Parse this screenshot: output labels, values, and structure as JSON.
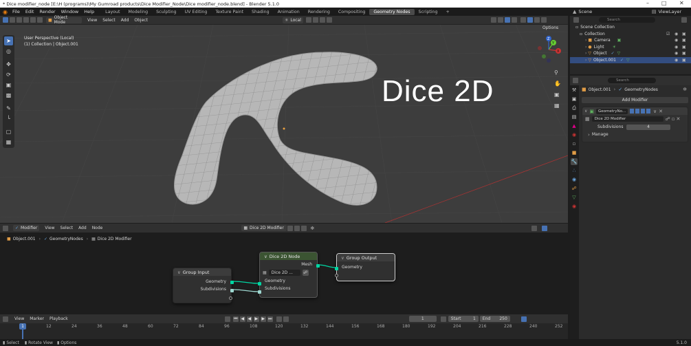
{
  "title_bar": {
    "title": "* Dice modifier_node [E:\\H (programs)\\My Gumroad products\\Dice Modifier_Node\\Dice modifier_node.blend] - Blender 5.1.0",
    "minimize": "–",
    "maximize": "□",
    "close": "✕"
  },
  "menu": [
    "File",
    "Edit",
    "Render",
    "Window",
    "Help"
  ],
  "workspaces": [
    {
      "label": "Layout",
      "active": false
    },
    {
      "label": "Modeling",
      "active": false
    },
    {
      "label": "Sculpting",
      "active": false
    },
    {
      "label": "UV Editing",
      "active": false
    },
    {
      "label": "Texture Paint",
      "active": false
    },
    {
      "label": "Shading",
      "active": false
    },
    {
      "label": "Animation",
      "active": false
    },
    {
      "label": "Rendering",
      "active": false
    },
    {
      "label": "Compositing",
      "active": false
    },
    {
      "label": "Geometry Nodes",
      "active": true
    },
    {
      "label": "Scripting",
      "active": false
    }
  ],
  "add_workspace": "+",
  "scene": "Scene",
  "view_layer": "ViewLayer",
  "viewport": {
    "mode": "Object Mode",
    "menus": [
      "View",
      "Select",
      "Add",
      "Object"
    ],
    "transform": "Local",
    "options": "Options",
    "overlay_line1": "User Perspective (Local)",
    "overlay_line2": "(1) Collection | Object.001",
    "big_text": "Dice 2D",
    "gizmo": {
      "x": "X",
      "y": "Y",
      "z": "Z"
    }
  },
  "node_editor": {
    "type": "Modifier",
    "menus": [
      "View",
      "Select",
      "Add",
      "Node"
    ],
    "group_name": "Dice 2D Modifier",
    "breadcrumb": [
      "Object.001",
      "GeometryNodes",
      "Dice 2D Modifier"
    ],
    "group_input": {
      "title": "Group Input",
      "outputs": [
        "Geometry",
        "Subdivisions"
      ]
    },
    "dice_node": {
      "title": "Dice 2D Node",
      "output": "Mesh",
      "group_field": "Dice 2D ...",
      "inputs": [
        "Geometry",
        "Subdivisions"
      ]
    },
    "group_output": {
      "title": "Group Output",
      "input": "Geometry"
    }
  },
  "timeline": {
    "menus": [
      "View",
      "Marker",
      "Playback"
    ],
    "current_frame": "1",
    "start_label": "Start",
    "start": "1",
    "end_label": "End",
    "end": "250",
    "ticks": [
      "1",
      "12",
      "24",
      "36",
      "48",
      "60",
      "72",
      "84",
      "96",
      "108",
      "120",
      "132",
      "144",
      "156",
      "168",
      "180",
      "192",
      "204",
      "216",
      "228",
      "240",
      "252"
    ],
    "playhead": "1"
  },
  "status": {
    "select": "Select",
    "rotate": "Rotate View",
    "options": "Options",
    "version": "5.1.0"
  },
  "outliner": {
    "search_placeholder": "Search",
    "items": [
      {
        "label": "Scene Collection",
        "indent": 0
      },
      {
        "label": "Collection",
        "indent": 1
      },
      {
        "label": "Camera",
        "indent": 2
      },
      {
        "label": "Light",
        "indent": 2
      },
      {
        "label": "Object",
        "indent": 2
      },
      {
        "label": "Object.001",
        "indent": 2
      }
    ]
  },
  "properties": {
    "search_placeholder": "Search",
    "object": "Object.001",
    "modifier_tree": "GeometryNodes",
    "add_modifier": "Add Modifier",
    "modifier_name": "GeometryNo...",
    "node_group": "Dice 2D Modifier",
    "subdivisions_label": "Subdivisions",
    "subdivisions_value": "4",
    "manage": "Manage"
  },
  "colors": {
    "accent": "#4772b3",
    "geometry_socket": "#00d6a3",
    "dice_header": "#3b5432",
    "group_header": "#3c3c3c",
    "mesh": "#b7b7b7"
  }
}
